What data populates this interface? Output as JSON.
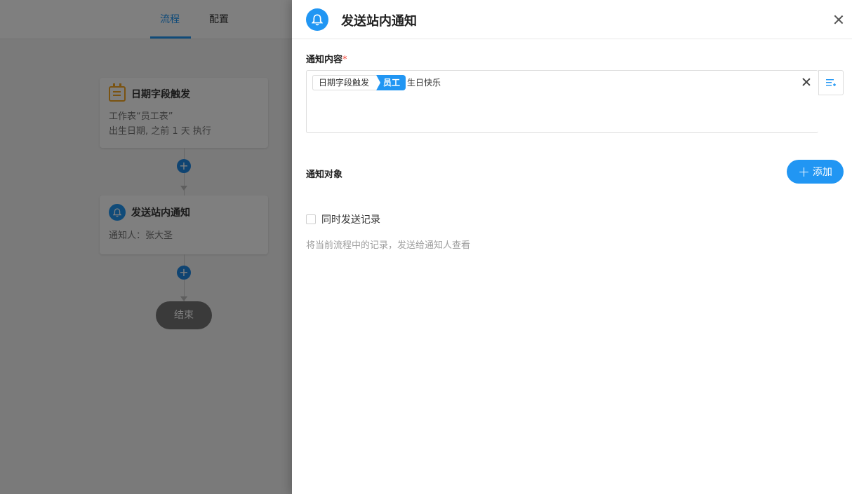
{
  "tabs": {
    "flow": "流程",
    "config": "配置"
  },
  "trigger_node": {
    "icon": "calendar-icon",
    "title": "日期字段触发",
    "line1": "工作表“员工表”",
    "line2": "出生日期, 之前 1 天 执行"
  },
  "notify_node": {
    "icon": "bell-icon",
    "title": "发送站内通知",
    "line1": "通知人：张大圣"
  },
  "end_node": {
    "label": "结束"
  },
  "drawer": {
    "title": "发送站内通知",
    "content_label": "通知内容",
    "required_mark": "*",
    "content": {
      "chip_source": "日期字段触发",
      "chip_field": "员工",
      "text": "生日快乐"
    },
    "target_label": "通知对象",
    "add_button": "添加",
    "checkbox_label": "同时发送记录",
    "hint": "将当前流程中的记录，发送给通知人查看"
  },
  "colors": {
    "accent": "#2196f3",
    "trigger_icon": "#f5a623",
    "required": "#f44336"
  }
}
